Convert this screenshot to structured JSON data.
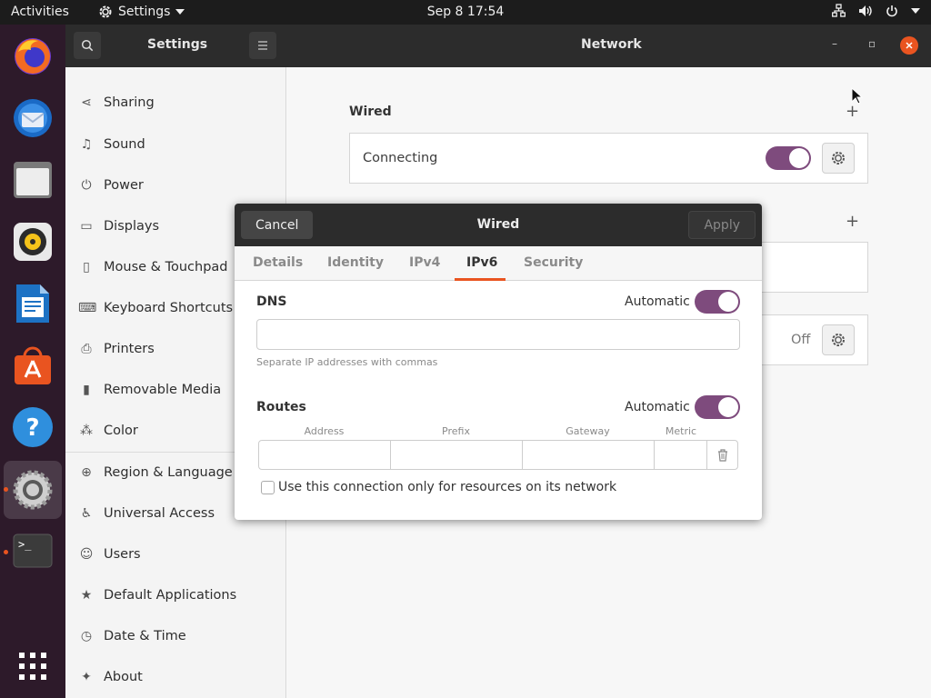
{
  "topbar": {
    "activities": "Activities",
    "app_name": "Settings",
    "clock": "Sep 8  17:54"
  },
  "header": {
    "sidebar_title": "Settings",
    "panel_title": "Network"
  },
  "sidebar": {
    "items": [
      {
        "label": "Sharing",
        "icon": "share-icon"
      },
      {
        "label": "Sound",
        "icon": "music-note-icon"
      },
      {
        "label": "Power",
        "icon": "power-icon"
      },
      {
        "label": "Displays",
        "icon": "display-icon"
      },
      {
        "label": "Mouse & Touchpad",
        "icon": "mouse-icon"
      },
      {
        "label": "Keyboard Shortcuts",
        "icon": "keyboard-icon"
      },
      {
        "label": "Printers",
        "icon": "printer-icon"
      },
      {
        "label": "Removable Media",
        "icon": "usb-drive-icon"
      },
      {
        "label": "Color",
        "icon": "color-icon"
      },
      {
        "label": "Region & Language",
        "icon": "globe-icon"
      },
      {
        "label": "Universal Access",
        "icon": "accessibility-icon"
      },
      {
        "label": "Users",
        "icon": "users-icon"
      },
      {
        "label": "Default Applications",
        "icon": "star-icon"
      },
      {
        "label": "Date & Time",
        "icon": "clock-icon"
      },
      {
        "label": "About",
        "icon": "sparkle-icon"
      }
    ]
  },
  "main": {
    "wired_heading": "Wired",
    "wired_status": "Connecting",
    "wired_switch": "on",
    "vpn_status": "Off"
  },
  "dialog": {
    "title": "Wired",
    "cancel_label": "Cancel",
    "apply_label": "Apply",
    "tabs": [
      "Details",
      "Identity",
      "IPv4",
      "IPv6",
      "Security"
    ],
    "selected_tab": "IPv6",
    "dns_label": "DNS",
    "dns_auto_label": "Automatic",
    "dns_auto_switch": "on",
    "dns_value": "",
    "dns_hint": "Separate IP addresses with commas",
    "routes_label": "Routes",
    "routes_auto_label": "Automatic",
    "routes_auto_switch": "on",
    "route_columns": [
      "Address",
      "Prefix",
      "Gateway",
      "Metric"
    ],
    "route_values": [
      "",
      "",
      "",
      ""
    ],
    "only_resources_label": "Use this connection only for resources on its network",
    "only_resources_checked": false
  },
  "colors": {
    "accent": "#e95420",
    "switch_on": "#7e4b7d",
    "dock_bg": "#2d1a2a",
    "header_bg": "#2c2c2c"
  }
}
